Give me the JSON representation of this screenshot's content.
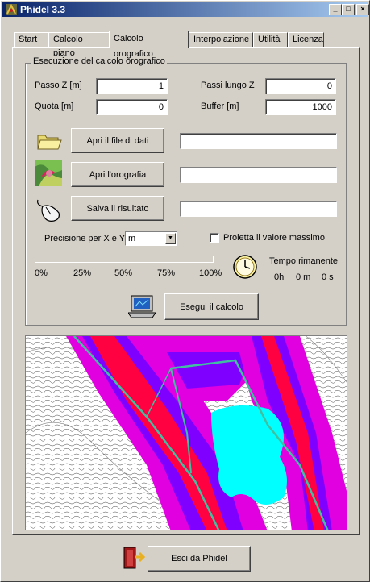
{
  "window": {
    "title": "Phidel 3.3",
    "minimize": "_",
    "maximize": "□",
    "close": "×"
  },
  "tabs": [
    "Start",
    "Calcolo piano",
    "Calcolo orografico",
    "Interpolazione",
    "Utilità",
    "Licenza"
  ],
  "active_tab": "Calcolo orografico",
  "group": {
    "title": "Esecuzione del calcolo orografico",
    "passo_z": {
      "label": "Passo Z [m]",
      "value": "1"
    },
    "passi_lungo_z": {
      "label": "Passi lungo Z",
      "value": "0"
    },
    "quota": {
      "label": "Quota [m]",
      "value": "0"
    },
    "buffer": {
      "label": "Buffer [m]",
      "value": "1000"
    },
    "open_data_button": "Apri il file di dati",
    "open_data_path": "",
    "open_orography_button": "Apri l'orografia",
    "open_orography_path": "",
    "save_result_button": "Salva il risultato",
    "save_result_path": "",
    "precision": {
      "label": "Precisione per X e Y",
      "value": "m"
    },
    "project_max": {
      "label": "Proietta il valore massimo",
      "checked": false
    },
    "progress": {
      "fraction": 0,
      "ticks": [
        "0%",
        "25%",
        "50%",
        "75%",
        "100%"
      ]
    },
    "time_remaining": {
      "label": "Tempo rimanente",
      "h": "0h",
      "m": "0 m",
      "s": "0 s"
    },
    "run_button": "Esegui il calcolo"
  },
  "exit_button": "Esci da Phidel",
  "icons": {
    "app": "phidel-app-icon",
    "folder": "folder-icon",
    "orography": "orography-map-icon",
    "mouse": "mouse-icon",
    "clock": "clock-icon",
    "computer": "computer-icon",
    "exit": "exit-door-icon"
  },
  "colors": {
    "titlebar_start": "#0a246a",
    "titlebar_end": "#a6caf0",
    "face": "#d4d0c8",
    "map_magenta": "#e000e0",
    "map_purple": "#8000ff",
    "map_red": "#ff0040",
    "map_lake": "#00ffff",
    "map_path": "#40c0a0"
  }
}
